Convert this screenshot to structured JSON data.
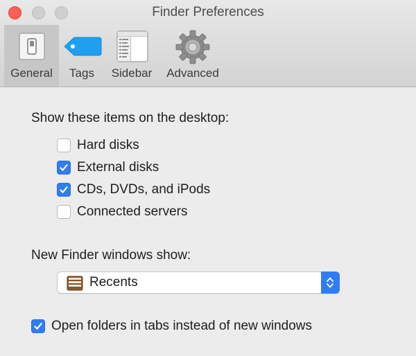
{
  "window": {
    "title": "Finder Preferences"
  },
  "toolbar": {
    "tabs": [
      {
        "label": "General",
        "icon": "switch-icon",
        "selected": true
      },
      {
        "label": "Tags",
        "icon": "tag-icon",
        "selected": false
      },
      {
        "label": "Sidebar",
        "icon": "sidebar-icon",
        "selected": false
      },
      {
        "label": "Advanced",
        "icon": "gear-icon",
        "selected": false
      }
    ]
  },
  "desktop": {
    "heading": "Show these items on the desktop:",
    "items": [
      {
        "label": "Hard disks",
        "checked": false
      },
      {
        "label": "External disks",
        "checked": true
      },
      {
        "label": "CDs, DVDs, and iPods",
        "checked": true
      },
      {
        "label": "Connected servers",
        "checked": false
      }
    ]
  },
  "new_window": {
    "heading": "New Finder windows show:",
    "selected": "Recents",
    "icon": "recents-cabinet-icon"
  },
  "tabs_option": {
    "label": "Open folders in tabs instead of new windows",
    "checked": true
  },
  "colors": {
    "accent": "#2f7df6",
    "tag_blue": "#1ea0f0",
    "close_red": "#fe5f57"
  }
}
